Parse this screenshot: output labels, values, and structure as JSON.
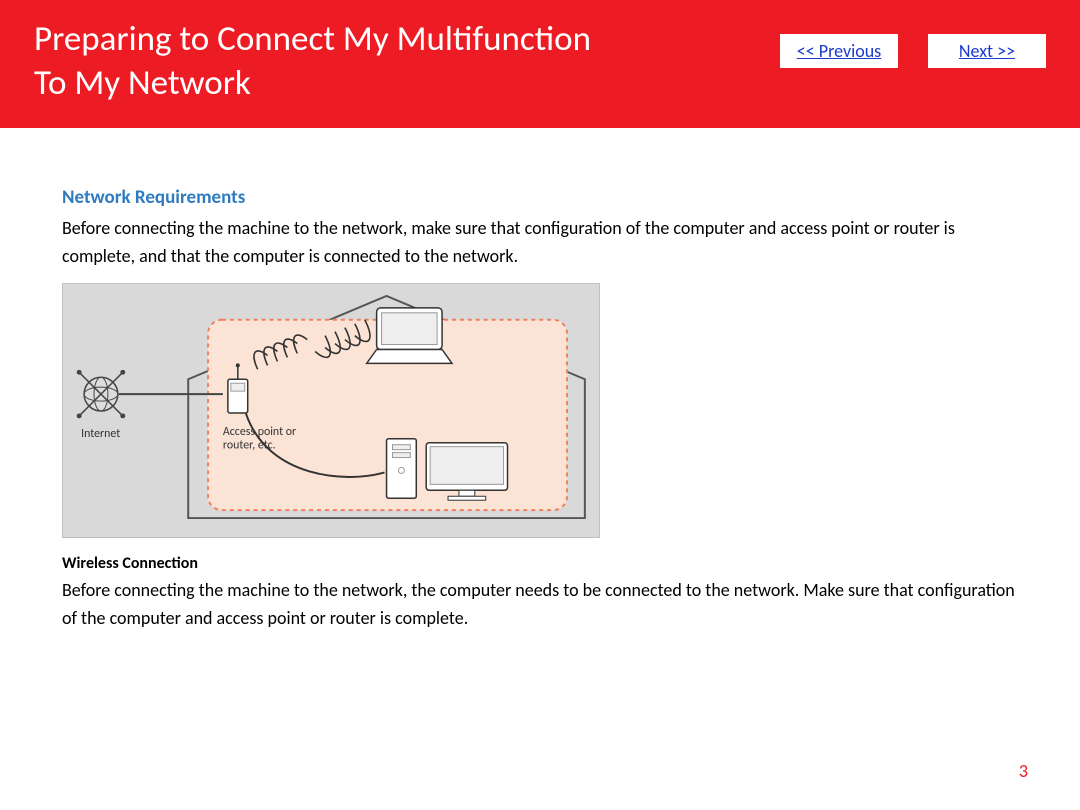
{
  "header": {
    "title": "Preparing to Connect My Multifunction\nTo My Network",
    "prev_label": "<< Previous",
    "next_label": "Next >>"
  },
  "section": {
    "heading": "Network Requirements",
    "intro": "Before connecting the machine to the network, make sure that configuration of the computer and access point or router is complete, and that the computer is connected to the network.",
    "diagram": {
      "internet_label": "Internet",
      "access_point_label": "Access point or\nrouter, etc."
    },
    "sub_heading": "Wireless Connection",
    "sub_body": "Before connecting the machine to the network, the computer needs to be connected to the network. Make sure that configuration of the computer and access point or router is complete."
  },
  "page_number": "3"
}
